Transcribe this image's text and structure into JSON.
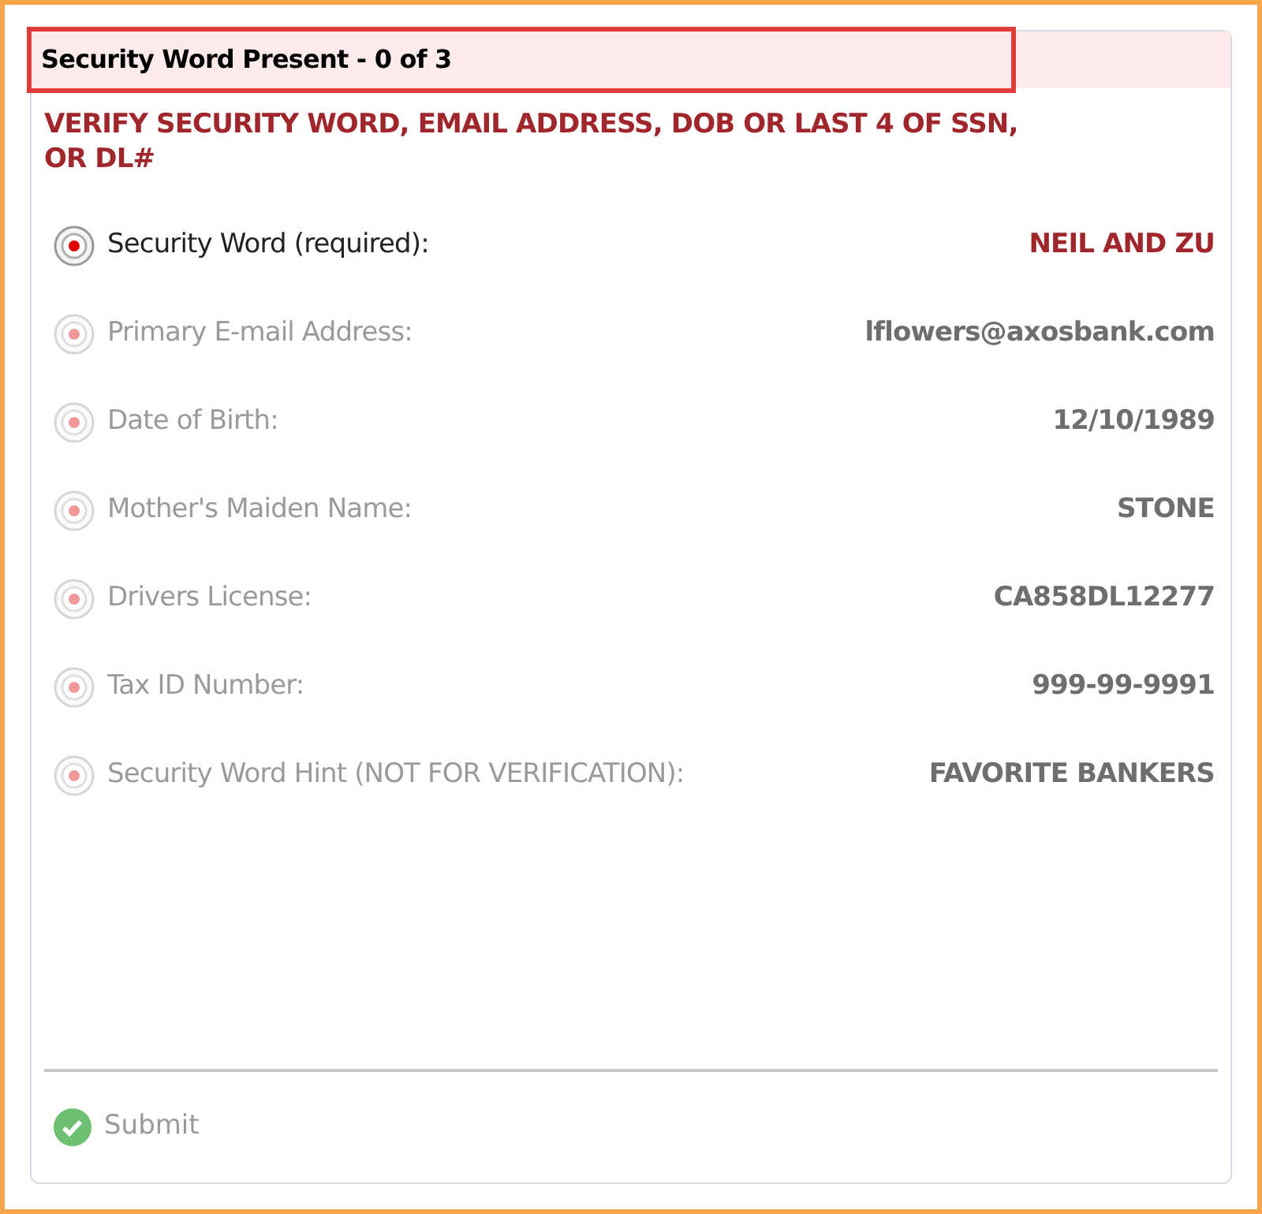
{
  "header": {
    "title": "Security Word Present - 0 of 3"
  },
  "warning": "VERIFY SECURITY WORD, EMAIL ADDRESS, DOB OR LAST 4 OF SSN, OR DL#",
  "fields": [
    {
      "label": "Security Word (required):",
      "value": "NEIL AND ZU",
      "disabled": false
    },
    {
      "label": "Primary E-mail Address:",
      "value": "lflowers@axosbank.com",
      "disabled": true
    },
    {
      "label": "Date of Birth:",
      "value": "12/10/1989",
      "disabled": true
    },
    {
      "label": "Mother's Maiden Name:",
      "value": "STONE",
      "disabled": true
    },
    {
      "label": "Drivers License:",
      "value": "CA858DL12277",
      "disabled": true
    },
    {
      "label": "Tax ID Number:",
      "value": "999-99-9991",
      "disabled": true
    },
    {
      "label": "Security Word Hint (NOT FOR VERIFICATION):",
      "value": "FAVORITE BANKERS",
      "disabled": true
    }
  ],
  "submit": {
    "label": "Submit",
    "disabled": true
  }
}
